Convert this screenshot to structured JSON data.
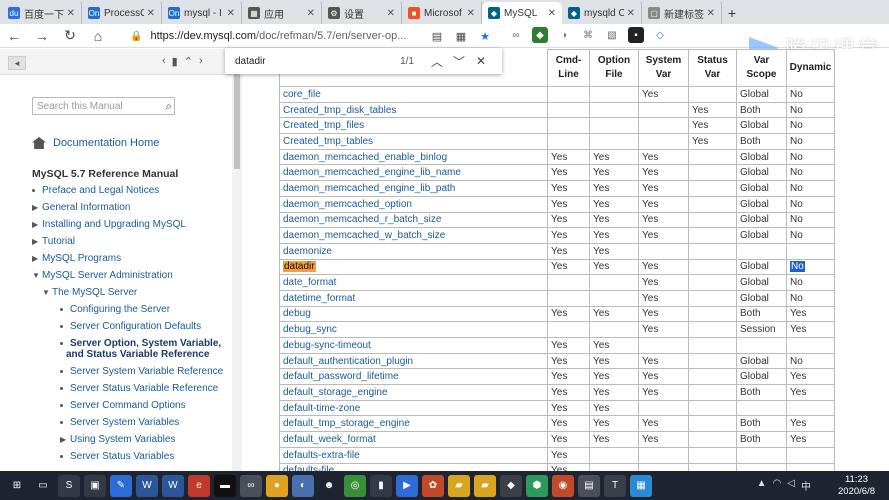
{
  "browser": {
    "tabs": [
      {
        "label": "百度一下",
        "icon_color": "#2b6de5",
        "icon_text": "du"
      },
      {
        "label": "ProcessO",
        "icon_color": "#1e6fd0",
        "icon_text": "On"
      },
      {
        "label": "mysql - I",
        "icon_color": "#1e6fd0",
        "icon_text": "On"
      },
      {
        "label": "应用",
        "icon_color": "#555555",
        "icon_text": "▦"
      },
      {
        "label": "设置",
        "icon_color": "#555555",
        "icon_text": "⚙"
      },
      {
        "label": "Microsof",
        "icon_color": "#f25022",
        "icon_text": "■"
      },
      {
        "label": "MySQL",
        "icon_color": "#00618a",
        "icon_text": "◆",
        "active": true
      },
      {
        "label": "mysqld C",
        "icon_color": "#00618a",
        "icon_text": "◆"
      },
      {
        "label": "新建标签",
        "icon_color": "#888888",
        "icon_text": "▢"
      }
    ],
    "new_tab_label": "+",
    "url_host": "https://dev.mysql.com",
    "url_path": "/doc/refman/5.7/en/server-op...",
    "watermark_text": "腾讯课堂"
  },
  "find_bar": {
    "query": "datadir",
    "count": "1/1"
  },
  "sidebar": {
    "search_placeholder": "Search this Manual",
    "home_label": "Documentation Home",
    "manual_title": "MySQL 5.7 Reference Manual",
    "nav": [
      {
        "label": "Preface and Legal Notices",
        "level": 0,
        "marker": "dot"
      },
      {
        "label": "General Information",
        "level": 0,
        "marker": "right"
      },
      {
        "label": "Installing and Upgrading MySQL",
        "level": 0,
        "marker": "right"
      },
      {
        "label": "Tutorial",
        "level": 0,
        "marker": "right"
      },
      {
        "label": "MySQL Programs",
        "level": 0,
        "marker": "right"
      },
      {
        "label": "MySQL Server Administration",
        "level": 0,
        "marker": "down"
      },
      {
        "label": "The MySQL Server",
        "level": 1,
        "marker": "down"
      },
      {
        "label": "Configuring the Server",
        "level": 2,
        "marker": "dot"
      },
      {
        "label": "Server Configuration Defaults",
        "level": 2,
        "marker": "dot"
      },
      {
        "label": "Server Option, System Variable,",
        "level": 2,
        "marker": "dot",
        "current": true
      },
      {
        "label": "and Status Variable Reference",
        "level": 2,
        "marker": "none",
        "current": true
      },
      {
        "label": "Server System Variable Reference",
        "level": 2,
        "marker": "dot"
      },
      {
        "label": "Server Status Variable Reference",
        "level": 2,
        "marker": "dot"
      },
      {
        "label": "Server Command Options",
        "level": 2,
        "marker": "dot"
      },
      {
        "label": "Server System Variables",
        "level": 2,
        "marker": "dot"
      },
      {
        "label": "Using System Variables",
        "level": 2,
        "marker": "right"
      },
      {
        "label": "Server Status Variables",
        "level": 2,
        "marker": "dot"
      }
    ]
  },
  "table": {
    "headers": [
      "Cmd-Line",
      "Option File",
      "System Var",
      "Status Var",
      "Var Scope",
      "Dynamic"
    ],
    "header_lines": [
      [
        "Cmd-",
        "Line"
      ],
      [
        "Option",
        "File"
      ],
      [
        "System",
        "Var"
      ],
      [
        "Status",
        "Var"
      ],
      [
        "Var",
        "Scope"
      ],
      [
        "Dynamic",
        ""
      ]
    ],
    "rows": [
      {
        "name": "core_file",
        "cmd": "",
        "opt": "",
        "sys": "Yes",
        "stat": "",
        "scope": "Global",
        "dyn": "No"
      },
      {
        "name": "Created_tmp_disk_tables",
        "cmd": "",
        "opt": "",
        "sys": "",
        "stat": "Yes",
        "scope": "Both",
        "dyn": "No"
      },
      {
        "name": "Created_tmp_files",
        "cmd": "",
        "opt": "",
        "sys": "",
        "stat": "Yes",
        "scope": "Global",
        "dyn": "No"
      },
      {
        "name": "Created_tmp_tables",
        "cmd": "",
        "opt": "",
        "sys": "",
        "stat": "Yes",
        "scope": "Both",
        "dyn": "No"
      },
      {
        "name": "daemon_memcached_enable_binlog",
        "cmd": "Yes",
        "opt": "Yes",
        "sys": "Yes",
        "stat": "",
        "scope": "Global",
        "dyn": "No"
      },
      {
        "name": "daemon_memcached_engine_lib_name",
        "cmd": "Yes",
        "opt": "Yes",
        "sys": "Yes",
        "stat": "",
        "scope": "Global",
        "dyn": "No"
      },
      {
        "name": "daemon_memcached_engine_lib_path",
        "cmd": "Yes",
        "opt": "Yes",
        "sys": "Yes",
        "stat": "",
        "scope": "Global",
        "dyn": "No"
      },
      {
        "name": "daemon_memcached_option",
        "cmd": "Yes",
        "opt": "Yes",
        "sys": "Yes",
        "stat": "",
        "scope": "Global",
        "dyn": "No"
      },
      {
        "name": "daemon_memcached_r_batch_size",
        "cmd": "Yes",
        "opt": "Yes",
        "sys": "Yes",
        "stat": "",
        "scope": "Global",
        "dyn": "No"
      },
      {
        "name": "daemon_memcached_w_batch_size",
        "cmd": "Yes",
        "opt": "Yes",
        "sys": "Yes",
        "stat": "",
        "scope": "Global",
        "dyn": "No"
      },
      {
        "name": "daemonize",
        "cmd": "Yes",
        "opt": "Yes",
        "sys": "",
        "stat": "",
        "scope": "",
        "dyn": ""
      },
      {
        "name": "datadir",
        "cmd": "Yes",
        "opt": "Yes",
        "sys": "Yes",
        "stat": "",
        "scope": "Global",
        "dyn": "No",
        "highlight": true
      },
      {
        "name": "date_format",
        "cmd": "",
        "opt": "",
        "sys": "Yes",
        "stat": "",
        "scope": "Global",
        "dyn": "No"
      },
      {
        "name": "datetime_format",
        "cmd": "",
        "opt": "",
        "sys": "Yes",
        "stat": "",
        "scope": "Global",
        "dyn": "No"
      },
      {
        "name": "debug",
        "cmd": "Yes",
        "opt": "Yes",
        "sys": "Yes",
        "stat": "",
        "scope": "Both",
        "dyn": "Yes"
      },
      {
        "name": "debug_sync",
        "cmd": "",
        "opt": "",
        "sys": "Yes",
        "stat": "",
        "scope": "Session",
        "dyn": "Yes"
      },
      {
        "name": "debug-sync-timeout",
        "cmd": "Yes",
        "opt": "Yes",
        "sys": "",
        "stat": "",
        "scope": "",
        "dyn": ""
      },
      {
        "name": "default_authentication_plugin",
        "cmd": "Yes",
        "opt": "Yes",
        "sys": "Yes",
        "stat": "",
        "scope": "Global",
        "dyn": "No"
      },
      {
        "name": "default_password_lifetime",
        "cmd": "Yes",
        "opt": "Yes",
        "sys": "Yes",
        "stat": "",
        "scope": "Global",
        "dyn": "Yes"
      },
      {
        "name": "default_storage_engine",
        "cmd": "Yes",
        "opt": "Yes",
        "sys": "Yes",
        "stat": "",
        "scope": "Both",
        "dyn": "Yes"
      },
      {
        "name": "default-time-zone",
        "cmd": "Yes",
        "opt": "Yes",
        "sys": "",
        "stat": "",
        "scope": "",
        "dyn": ""
      },
      {
        "name": "default_tmp_storage_engine",
        "cmd": "Yes",
        "opt": "Yes",
        "sys": "Yes",
        "stat": "",
        "scope": "Both",
        "dyn": "Yes"
      },
      {
        "name": "default_week_format",
        "cmd": "Yes",
        "opt": "Yes",
        "sys": "Yes",
        "stat": "",
        "scope": "Both",
        "dyn": "Yes"
      },
      {
        "name": "defaults-extra-file",
        "cmd": "Yes",
        "opt": "",
        "sys": "",
        "stat": "",
        "scope": "",
        "dyn": ""
      },
      {
        "name": "defaults-file",
        "cmd": "Yes",
        "opt": "",
        "sys": "",
        "stat": "",
        "scope": "",
        "dyn": ""
      }
    ]
  },
  "taskbar": {
    "time": "11:23",
    "date": "2020/6/8",
    "apps": [
      {
        "icon": "windows-start-icon",
        "glyph": "⊞",
        "color": "#1f2530"
      },
      {
        "icon": "task-view-icon",
        "glyph": "▭",
        "color": "#1f2530"
      },
      {
        "icon": "app-icon",
        "glyph": "S",
        "color": "#333a46"
      },
      {
        "icon": "store-icon",
        "glyph": "▣",
        "color": "#333a46"
      },
      {
        "icon": "app-icon",
        "glyph": "✎",
        "color": "#2d6bd6"
      },
      {
        "icon": "word-icon",
        "glyph": "W",
        "color": "#2b579a"
      },
      {
        "icon": "word-icon",
        "glyph": "W",
        "color": "#2b579a"
      },
      {
        "icon": "app-icon",
        "glyph": "e",
        "color": "#c0392b"
      },
      {
        "icon": "terminal-icon",
        "glyph": "▬",
        "color": "#111111"
      },
      {
        "icon": "app-icon",
        "glyph": "∞",
        "color": "#4a4f5a"
      },
      {
        "icon": "chrome-icon",
        "glyph": "●",
        "color": "#e0a020"
      },
      {
        "icon": "app-icon",
        "glyph": "◐",
        "color": "#4a6fb0"
      },
      {
        "icon": "qq-icon",
        "glyph": "☻",
        "color": "#1f2530"
      },
      {
        "icon": "chrome-icon",
        "glyph": "◎",
        "color": "#3a8f3a"
      },
      {
        "icon": "app-icon",
        "glyph": "▮",
        "color": "#333a46"
      },
      {
        "icon": "app-icon",
        "glyph": "▶",
        "color": "#2d6bd6"
      },
      {
        "icon": "app-icon",
        "glyph": "✿",
        "color": "#c04a2a"
      },
      {
        "icon": "folder-icon",
        "glyph": "▰",
        "color": "#d9a520"
      },
      {
        "icon": "folder-icon",
        "glyph": "▰",
        "color": "#d9a520"
      },
      {
        "icon": "app-icon",
        "glyph": "◆",
        "color": "#3a3f4a"
      },
      {
        "icon": "app-icon",
        "glyph": "⬢",
        "color": "#2b9a5a"
      },
      {
        "icon": "app-icon",
        "glyph": "◉",
        "color": "#c04a2a"
      },
      {
        "icon": "app-icon",
        "glyph": "▤",
        "color": "#4a4f5a"
      },
      {
        "icon": "app-icon",
        "glyph": "T",
        "color": "#3a3f4a"
      },
      {
        "icon": "app-icon",
        "glyph": "▦",
        "color": "#2b8ad6"
      }
    ]
  }
}
